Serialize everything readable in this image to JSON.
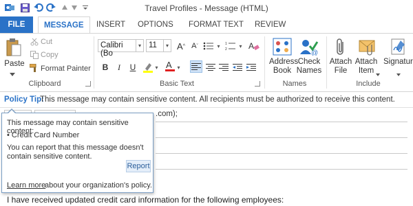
{
  "window": {
    "title": "Travel Profiles - Message (HTML)"
  },
  "qat": {
    "icons": [
      "outlook-icon",
      "save-icon",
      "undo-icon",
      "redo-icon",
      "up-icon",
      "down-icon",
      "customize-icon"
    ]
  },
  "tabs": [
    {
      "label": "FILE"
    },
    {
      "label": "MESSAGE"
    },
    {
      "label": "INSERT"
    },
    {
      "label": "OPTIONS"
    },
    {
      "label": "FORMAT TEXT"
    },
    {
      "label": "REVIEW"
    }
  ],
  "ribbon": {
    "clipboard": {
      "paste": "Paste",
      "cut": "Cut",
      "copy": "Copy",
      "format_painter": "Format Painter",
      "group": "Clipboard"
    },
    "basic_text": {
      "font": "Calibri (Bo",
      "size": "11",
      "group": "Basic Text"
    },
    "names": {
      "address_book_1": "Address",
      "address_book_2": "Book",
      "check_names_1": "Check",
      "check_names_2": "Names",
      "group": "Names"
    },
    "include": {
      "attach_file_1": "Attach",
      "attach_file_2": "File",
      "attach_item_1": "Attach",
      "attach_item_2": "Item",
      "signature_1": "Signature",
      "group": "Include"
    }
  },
  "policy_tip": {
    "label": "Policy Tip:",
    "text": "This message may contain sensitive content. All recipients must be authorized to receive this content."
  },
  "compose": {
    "to_text": ".com);",
    "body_line": "I have received updated credit card information for the following employees:"
  },
  "popup": {
    "heading": "This message may contain sensitive content:",
    "item": "• Credit Card Number",
    "report_line_1": "You can report that this message doesn't",
    "report_line_2": "contain sensitive content.",
    "report_button": "Report",
    "learn_more": "Learn more",
    "learn_more_rest": "about your organization's policy."
  },
  "colors": {
    "accent": "#2a72c7",
    "popup_border": "#7a9ec4"
  }
}
